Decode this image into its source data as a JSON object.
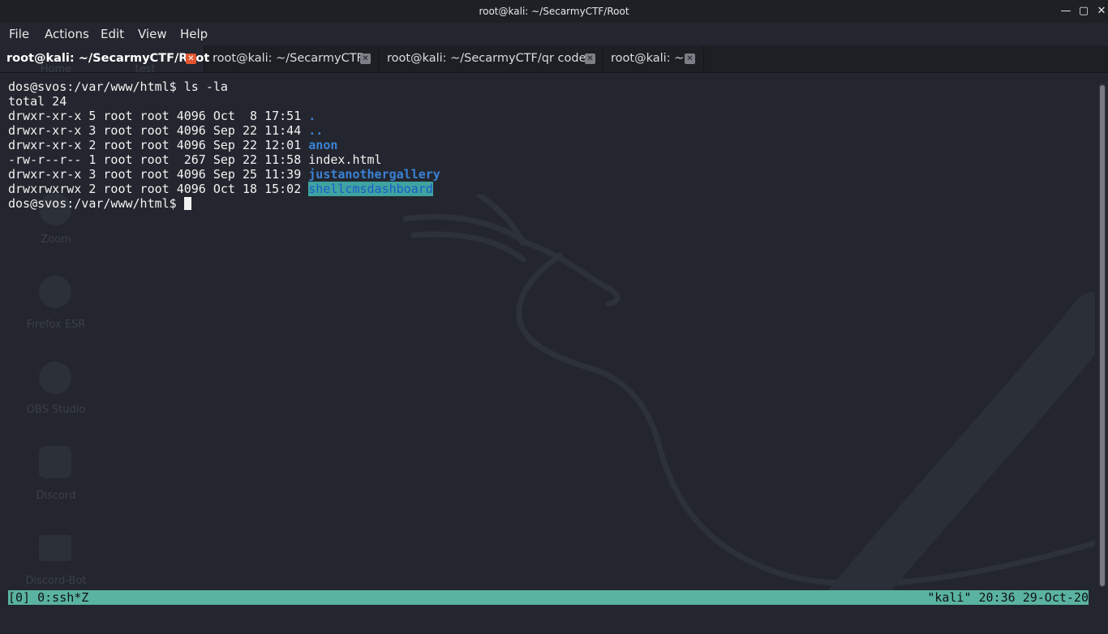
{
  "window": {
    "title": "root@kali: ~/SecarmyCTF/Root",
    "minimize_icon": "minimize-icon",
    "maximize_icon": "maximize-icon",
    "close_icon": "close-icon"
  },
  "menu": [
    "File",
    "Actions",
    "Edit",
    "View",
    "Help"
  ],
  "tabs": [
    {
      "label": "root@kali: ~/SecarmyCTF/Root",
      "active": true
    },
    {
      "label": "root@kali: ~/SecarmyCTF",
      "active": false
    },
    {
      "label": "root@kali: ~/SecarmyCTF/qr codes",
      "active": false
    },
    {
      "label": "root@kali: ~",
      "active": false
    }
  ],
  "desktop_icons": [
    "Home",
    "test",
    "Zoom",
    "Firefox ESR",
    "OBS Studio",
    "Discord",
    "Discord-Bot"
  ],
  "terminal": {
    "prompt": "dos@svos:/var/www/html$ ",
    "command": "ls -la",
    "total": "total 24",
    "entries": [
      {
        "meta": "drwxr-xr-x 5 root root 4096 Oct  8 17:51 ",
        "name": "."
      },
      {
        "meta": "drwxr-xr-x 3 root root 4096 Sep 22 11:44 ",
        "name": ".."
      },
      {
        "meta": "drwxr-xr-x 2 root root 4096 Sep 22 12:01 ",
        "name": "anon"
      },
      {
        "meta": "-rw-r--r-- 1 root root  267 Sep 22 11:58 ",
        "name": "index.html"
      },
      {
        "meta": "drwxr-xr-x 3 root root 4096 Sep 25 11:39 ",
        "name": "justanothergallery"
      },
      {
        "meta": "drwxrwxrwx 2 root root 4096 Oct 18 15:02 ",
        "name": "shellcmsdashboard"
      }
    ],
    "final_prompt": "dos@svos:/var/www/html$ "
  },
  "tmux": {
    "left": "[0] 0:ssh*Z",
    "right": "\"kali\" 20:36 29-Oct-20"
  },
  "colors": {
    "background": "#23262e",
    "directory": "#3b82d6",
    "status_bar": "#5ab3a1",
    "active_tab_close": "#e0552f"
  }
}
